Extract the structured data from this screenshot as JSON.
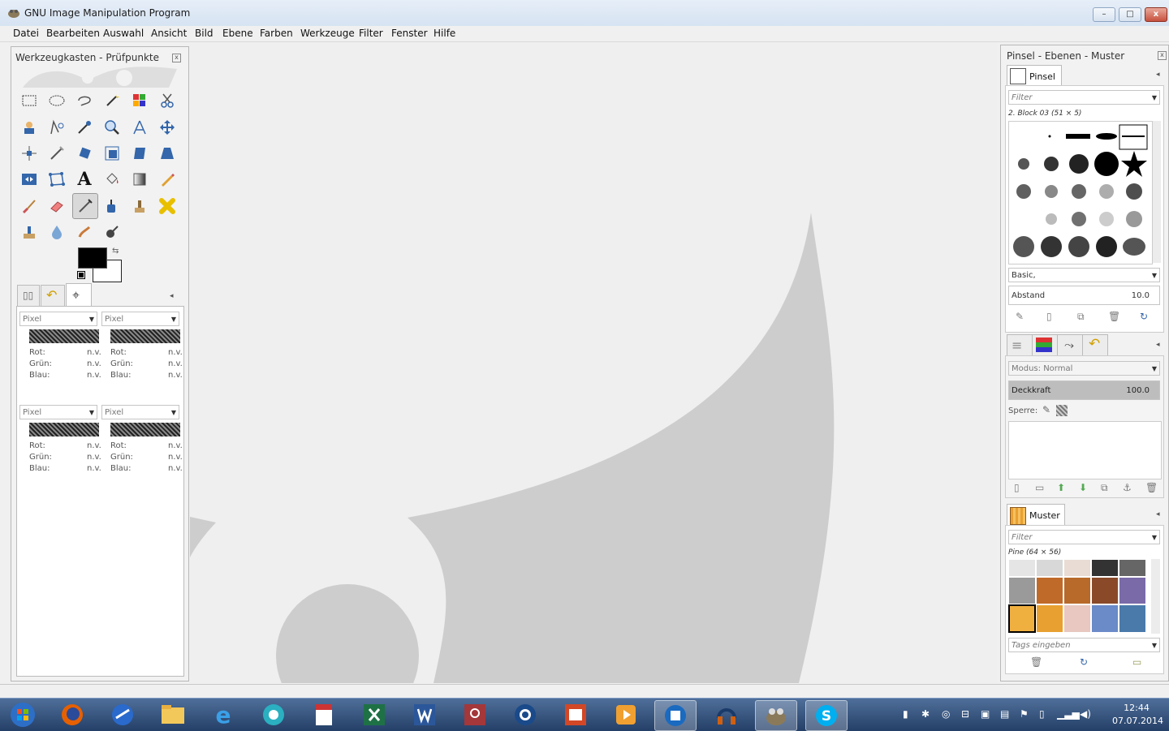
{
  "window": {
    "title": "GNU Image Manipulation Program",
    "min": "–",
    "max": "□",
    "close": "x"
  },
  "menu": [
    "Datei",
    "Bearbeiten",
    "Auswahl",
    "Ansicht",
    "Bild",
    "Ebene",
    "Farben",
    "Werkzeuge",
    "Filter",
    "Fenster",
    "Hilfe"
  ],
  "toolbox": {
    "title": "Werkzeugkasten - Prüfpunkte",
    "tools": [
      "rect-select",
      "ellipse-select",
      "free-select",
      "fuzzy-select",
      "select-by-color",
      "scissors",
      "foreground-select",
      "paths",
      "color-picker",
      "zoom",
      "measure",
      "move",
      "align",
      "crop",
      "rotate",
      "scale",
      "shear",
      "perspective",
      "flip",
      "cage-transform",
      "text",
      "bucket-fill",
      "blend",
      "pencil",
      "paintbrush",
      "eraser",
      "airbrush",
      "ink",
      "clone",
      "heal",
      "perspective-clone",
      "blur",
      "smudge",
      "dodge-burn"
    ],
    "pointers": [
      {
        "unit": "Pixel",
        "labels": [
          "Rot:",
          "Grün:",
          "Blau:"
        ],
        "values": [
          "n.v.",
          "n.v.",
          "n.v."
        ]
      },
      {
        "unit": "Pixel",
        "labels": [
          "Rot:",
          "Grün:",
          "Blau:"
        ],
        "values": [
          "n.v.",
          "n.v.",
          "n.v."
        ]
      },
      {
        "unit": "Pixel",
        "labels": [
          "Rot:",
          "Grün:",
          "Blau:"
        ],
        "values": [
          "n.v.",
          "n.v.",
          "n.v."
        ]
      },
      {
        "unit": "Pixel",
        "labels": [
          "Rot:",
          "Grün:",
          "Blau:"
        ],
        "values": [
          "n.v.",
          "n.v.",
          "n.v."
        ]
      }
    ]
  },
  "right": {
    "title": "Pinsel - Ebenen - Muster",
    "brushes": {
      "tab": "Pinsel",
      "filter": "Filter",
      "selected": "2. Block 03 (51 × 5)",
      "preset": "Basic,",
      "spacing_label": "Abstand",
      "spacing_value": "10.0"
    },
    "layers": {
      "mode_label": "Modus:",
      "mode_value": "Normal",
      "opacity_label": "Deckkraft",
      "opacity_value": "100.0",
      "lock_label": "Sperre:"
    },
    "patterns": {
      "tab": "Muster",
      "filter": "Filter",
      "selected": "Pine (64 × 56)",
      "tags": "Tags eingeben"
    }
  },
  "taskbar": {
    "time": "12:44",
    "date": "07.07.2014"
  }
}
